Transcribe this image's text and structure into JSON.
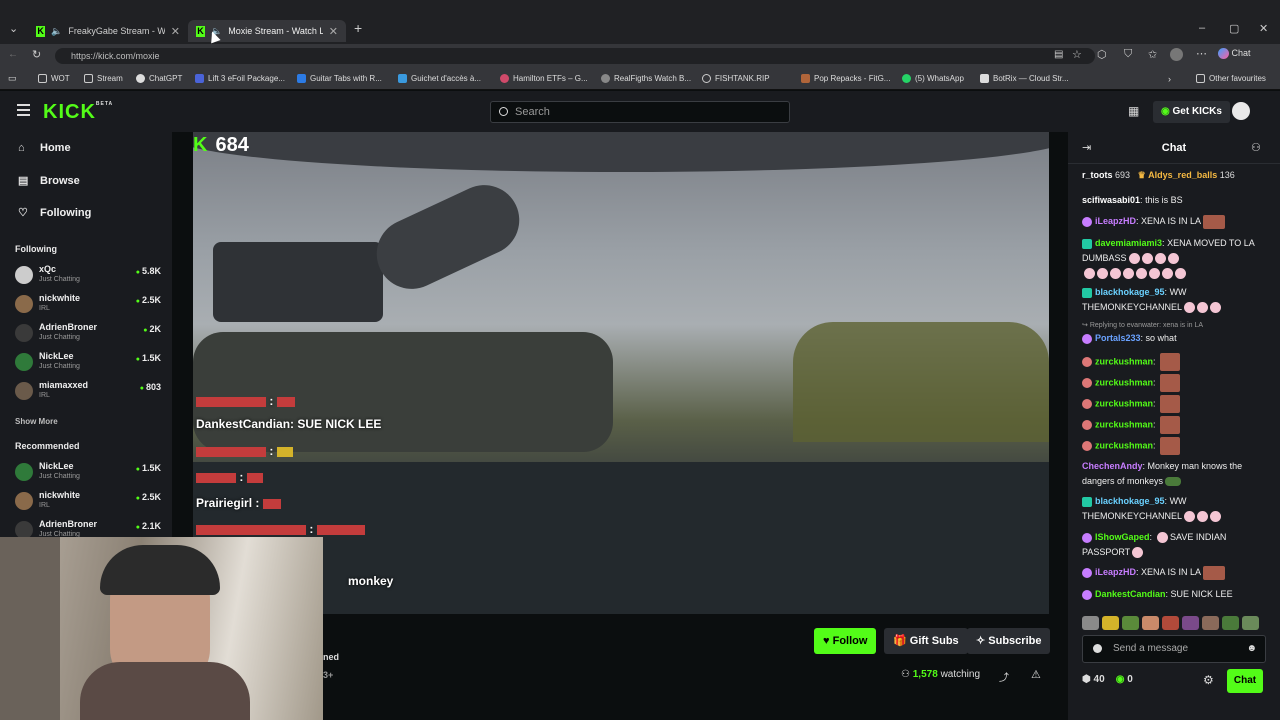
{
  "browser": {
    "tabs": [
      {
        "label": "FreakyGabe Stream - Watch L"
      },
      {
        "label": "Moxie Stream - Watch Live on"
      }
    ],
    "url": "https://kick.com/moxie",
    "profile_chat_label": "Chat",
    "bookmarks": [
      "WOT",
      "Stream",
      "ChatGPT",
      "Lift 3 eFoil Package...",
      "Guitar Tabs with R...",
      "Guichet d'accès à...",
      "Hamilton ETFs – G...",
      "RealFigths Watch B...",
      "FISHTANK.RIP",
      "Pop Repacks - FitG...",
      "(5) WhatsApp",
      "BotRix — Cloud Str..."
    ],
    "other_favourites": "Other favourites"
  },
  "header": {
    "logo": "KICK",
    "logo_badge": "BETA",
    "search_placeholder": "Search",
    "get_kicks": "Get KICKs"
  },
  "sidebar": {
    "nav": [
      {
        "label": "Home",
        "icon": "home-icon"
      },
      {
        "label": "Browse",
        "icon": "browse-icon"
      },
      {
        "label": "Following",
        "icon": "heart-icon"
      }
    ],
    "following_title": "Following",
    "following": [
      {
        "name": "xQc",
        "category": "Just Chatting",
        "viewers": "5.8K"
      },
      {
        "name": "nickwhite",
        "category": "IRL",
        "viewers": "2.5K"
      },
      {
        "name": "AdrienBroner",
        "category": "Just Chatting",
        "viewers": "2K"
      },
      {
        "name": "NickLee",
        "category": "Just Chatting",
        "viewers": "1.5K"
      },
      {
        "name": "miamaxxed",
        "category": "IRL",
        "viewers": "803"
      }
    ],
    "show_more": "Show More",
    "recommended_title": "Recommended",
    "recommended": [
      {
        "name": "NickLee",
        "category": "Just Chatting",
        "viewers": "1.5K"
      },
      {
        "name": "nickwhite",
        "category": "IRL",
        "viewers": "2.5K"
      },
      {
        "name": "AdrienBroner",
        "category": "Just Chatting",
        "viewers": "2.1K"
      }
    ]
  },
  "video": {
    "kick_count": "684",
    "overlay_chat": [
      {
        "user": "DankestCandian",
        "text": ": SUE NICK LEE"
      },
      {
        "user": "Prairiegirl",
        "text": ":"
      },
      {
        "user": "",
        "text": "monkey"
      }
    ]
  },
  "below_video": {
    "follow": "Follow",
    "gift_subs": "Gift Subs",
    "subscribe": "Subscribe",
    "watching_count": "1,578",
    "watching_label": "watching",
    "frag_1": "ned",
    "frag_2": "3+"
  },
  "chat": {
    "title": "Chat",
    "pinned": [
      {
        "user": "r_toots",
        "count": "693"
      },
      {
        "user": "Aldys_red_balls",
        "count": "136"
      }
    ],
    "messages": [
      {
        "user": "scifiwasabi01",
        "text": "this is BS",
        "color": "#ffffff"
      },
      {
        "user": "iLeapzHD",
        "text": "XENA IS IN LA",
        "color": "#c77dff"
      },
      {
        "user": "davemiamiami3",
        "text": "XENA MOVED TO LA DUMBASS",
        "color": "#53fc18"
      },
      {
        "user": "blackhokage_95",
        "text": "WW THEMONKEYCHANNEL",
        "color": "#6ad1ff"
      },
      {
        "reply": "Replying to evanwater: xena is in LA"
      },
      {
        "user": "Portals233",
        "text": "so what",
        "color": "#6aa2ff"
      },
      {
        "user": "zurckushman",
        "text": "",
        "color": "#53fc18"
      },
      {
        "user": "zurckushman",
        "text": "",
        "color": "#53fc18"
      },
      {
        "user": "zurckushman",
        "text": "",
        "color": "#53fc18"
      },
      {
        "user": "zurckushman",
        "text": "",
        "color": "#53fc18"
      },
      {
        "user": "zurckushman",
        "text": "",
        "color": "#53fc18"
      },
      {
        "user": "ChechenAndy",
        "text": "Monkey man knows the dangers of monkeys",
        "color": "#c77dff"
      },
      {
        "user": "blackhokage_95",
        "text": "WW THEMONKEYCHANNEL",
        "color": "#6ad1ff"
      },
      {
        "user": "IShowGaped",
        "text": "SAVE INDIAN PASSPORT",
        "color": "#53fc18"
      },
      {
        "user": "iLeapzHD",
        "text": "XENA IS IN LA",
        "color": "#c77dff"
      },
      {
        "user": "DankestCandian",
        "text": "SUE NICK LEE",
        "color": "#53fc18"
      }
    ],
    "send_placeholder": "Send a message",
    "likes": "40",
    "kicks": "0",
    "chat_button": "Chat"
  },
  "colors": {
    "accent": "#53fc18",
    "bg": "#0b0e0f",
    "panel": "#191b1f"
  }
}
